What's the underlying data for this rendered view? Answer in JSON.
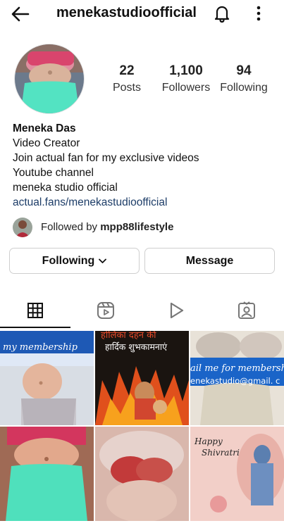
{
  "header": {
    "title": "menekastudioofficial",
    "back_icon": "back-arrow-icon",
    "bell_icon": "bell-icon",
    "more_icon": "more-vertical-icon"
  },
  "profile": {
    "stats": [
      {
        "value": "22",
        "label": "Posts"
      },
      {
        "value": "1,100",
        "label": "Followers"
      },
      {
        "value": "94",
        "label": "Following"
      }
    ],
    "name": "Meneka Das",
    "bio_lines": [
      "Video Creator",
      "Join actual fan for my exclusive videos",
      "Youtube channel",
      "meneka studio official"
    ],
    "link": "actual.fans/menekastudioofficial",
    "followed_by_prefix": "Followed by ",
    "followed_by_user": "mpp88lifestyle"
  },
  "actions": {
    "following_label": "Following",
    "message_label": "Message"
  },
  "tabs": [
    {
      "icon": "grid-icon",
      "active": true
    },
    {
      "icon": "reels-icon",
      "active": false
    },
    {
      "icon": "play-icon",
      "active": false
    },
    {
      "icon": "tagged-icon",
      "active": false
    }
  ],
  "posts": {
    "post1_text": "my membership",
    "post2_text_top": "हार्दिक शुभकामनाएं",
    "post2_text_title": "होलिका दहन की",
    "post3_text_line1": "ail me for membersh",
    "post3_text_line2": "enekastudio@gmail. c",
    "post6_text_line1": "Happy",
    "post6_text_line2": "Shivratri"
  },
  "colors": {
    "link": "#1d3d68",
    "border": "#cfcfcf",
    "text": "#111111"
  }
}
